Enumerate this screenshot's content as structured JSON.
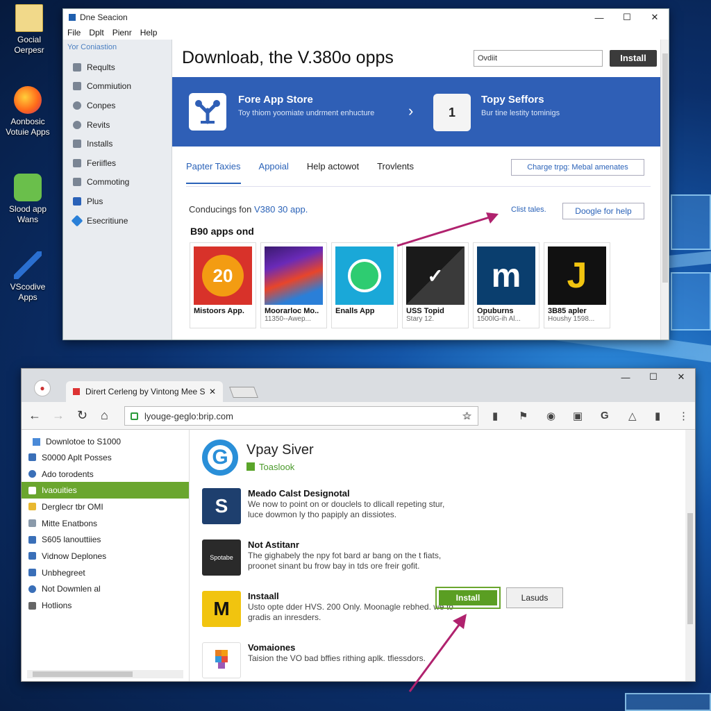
{
  "desktop": {
    "icons": [
      {
        "label": "Gocial Oerpesr"
      },
      {
        "label": "Aonbosic Votuie Apps"
      },
      {
        "label": "Slood app Wans"
      },
      {
        "label": "VScodive Apps"
      }
    ]
  },
  "window1": {
    "title": "Dne Seacion",
    "menu": [
      "File",
      "Dplt",
      "Pienr",
      "Help"
    ],
    "sidebar_header": "Yor Coniastion",
    "sidebar": [
      "Reqults",
      "Commiution",
      "Conpes",
      "Revits",
      "Installs",
      "Feriifles",
      "Commoting",
      "Plus",
      "Esecritiune"
    ],
    "heading": "Downloab, the V.380o opps",
    "search_value": "Ovdiit",
    "install_label": "Install",
    "banner": {
      "left_title": "Fore App Store",
      "left_sub": "Toy thiom yoomiate undrment enhucture",
      "right_badge": "1",
      "right_title": "Topy Seffors",
      "right_sub": "Bur tine lestity tominigs"
    },
    "tabs": [
      "Papter Taxies",
      "Appoial",
      "Help actowot",
      "Trovlents"
    ],
    "change_button": "Charge trpg: Mebal amenates",
    "conducting_prefix": "Conducings fon",
    "conducting_link": "V380 30 app.",
    "clist_label": "Clist tales.",
    "google_button": "Doogle for help",
    "apps_heading": "B90 apps ond",
    "apps": [
      {
        "name": "Mistoors App.",
        "sub": "",
        "art": "20",
        "color": "#d8322a"
      },
      {
        "name": "Moorarloc Mo..",
        "sub": "11350--Awep...",
        "art": "",
        "color": "#3a1a6e"
      },
      {
        "name": "Enalls App",
        "sub": "",
        "art": "",
        "color": "#1aa8d8"
      },
      {
        "name": "USS Topid",
        "sub": "Stary 12.",
        "art": "",
        "color": "#1a1a1a"
      },
      {
        "name": "Opuburns",
        "sub": "1500lG-ih Al...",
        "art": "m",
        "color": "#0a3e6e"
      },
      {
        "name": "3B85 apler",
        "sub": "Houshy 1598...",
        "art": "J",
        "color": "#111111"
      }
    ]
  },
  "window2": {
    "tab_title": "Dirert Cerleng by Vintong Mee S",
    "url": "lyouge-geglo:brip.com",
    "left_header": "Downlotoe to S1000",
    "left_items": [
      "S0000 Aplt Posses",
      "Ado torodents",
      "Ivaouities",
      "Derglecr tbr OMI",
      "Mitte Enatbons",
      "S605 lanouttiies",
      "Vidnow Deplones",
      "Unbhegreet",
      "Not Dowmlen al",
      "Hotlions"
    ],
    "selected_index": 2,
    "product_title": "Vpay Siver",
    "product_sub": "Toaslook",
    "rows": [
      {
        "title": "Meado Calst Designotal",
        "desc": "We now to point on or douclels to dlicall repeting stur, luce dowmon ly tho papiply an dissiotes.",
        "icon_color": "#1e3f6e",
        "icon_text": "S"
      },
      {
        "title": "Not Astitanr",
        "desc": "The gighabely the npy fot bard ar bang on the t fiats, proonet sinant bu frow bay in tds ore freir gofit.",
        "icon_color": "#2a2a2a",
        "icon_text": "Spotabe"
      },
      {
        "title": "Instaall",
        "desc": "Usto opte dder HVS. 200 Only. Moonagle rebhed. we to gradis an inresders.",
        "icon_color": "#f1c40f",
        "icon_text": "M"
      },
      {
        "title": "Vomaiones",
        "desc": "Taision the VO bad bffies rithing aplk. tfiessdors.",
        "icon_color": "#ffffff",
        "icon_text": ""
      }
    ],
    "install_label": "Install",
    "lasuds_label": "Lasuds",
    "accent": "#6aa62e"
  }
}
